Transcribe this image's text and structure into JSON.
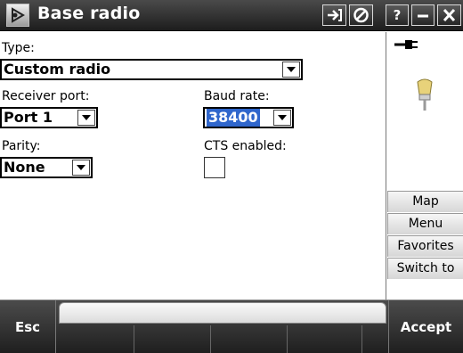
{
  "window": {
    "title": "Base radio",
    "app_icon": "satellite-dish-icon",
    "title_buttons": {
      "connect_icon": "arrow-into-icon",
      "stop_icon": "no-entry-icon",
      "help_label": "?",
      "minimize_icon": "minimize-icon",
      "close_icon": "close-icon"
    }
  },
  "form": {
    "type": {
      "label": "Type:",
      "value": "Custom radio"
    },
    "receiver_port": {
      "label": "Receiver port:",
      "value": "Port 1"
    },
    "baud_rate": {
      "label": "Baud rate:",
      "value": "38400"
    },
    "parity": {
      "label": "Parity:",
      "value": "None"
    },
    "cts": {
      "label": "CTS enabled:",
      "checked": false
    }
  },
  "side_panel": {
    "status_icons": [
      "power-plug-icon",
      "gnss-receiver-icon"
    ],
    "buttons": [
      "Map",
      "Menu",
      "Favorites",
      "Switch to"
    ]
  },
  "bottom_bar": {
    "esc_label": "Esc",
    "accept_label": "Accept"
  }
}
